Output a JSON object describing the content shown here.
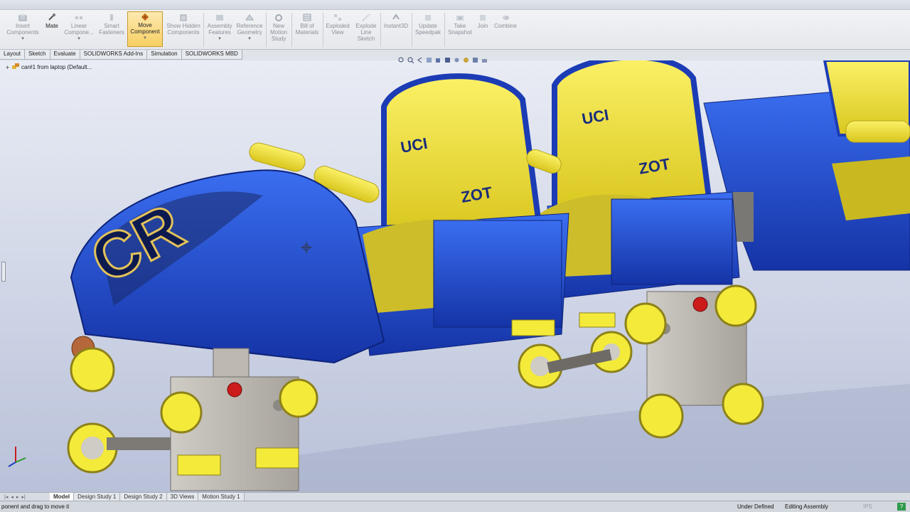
{
  "ribbon": {
    "buttons": [
      {
        "label": "Insert Components",
        "dropdown": true
      },
      {
        "label": "Mate"
      },
      {
        "label": "Linear Compone...",
        "dropdown": true
      },
      {
        "label": "Smart Fasteners"
      },
      {
        "label": "Move Component",
        "dropdown": true,
        "active": true
      },
      {
        "label": "Show Hidden Components"
      },
      {
        "label": "Assembly Features",
        "dropdown": true
      },
      {
        "label": "Reference Geometry",
        "dropdown": true
      },
      {
        "label": "New Motion Study"
      },
      {
        "label": "Bill of Materials"
      },
      {
        "label": "Exploded View"
      },
      {
        "label": "Explode Line Sketch"
      },
      {
        "label": "Instant3D"
      },
      {
        "label": "Update Speedpak"
      },
      {
        "label": "Take Snapshot"
      },
      {
        "label": "Join"
      },
      {
        "label": "Combine"
      }
    ]
  },
  "tabs": [
    "Layout",
    "Sketch",
    "Evaluate",
    "SOLIDWORKS Add-Ins",
    "Simulation",
    "SOLIDWORKS MBD"
  ],
  "tree": {
    "root": "car#1 from laptop  (Default..."
  },
  "model_art": {
    "hood_logo": "CR",
    "seat_logo": "UCI",
    "seat_text": "ZOT",
    "brand_color": "#1f45c7",
    "seat_color": "#f2e53a"
  },
  "bottom_tabs": [
    "Model",
    "Design Study 1",
    "Design Study 2",
    "3D Views",
    "Motion Study 1"
  ],
  "status": {
    "message": "ponent and drag to move it",
    "state": "Under Defined",
    "mode": "Editing Assembly",
    "units": "IPS",
    "help": "?"
  }
}
